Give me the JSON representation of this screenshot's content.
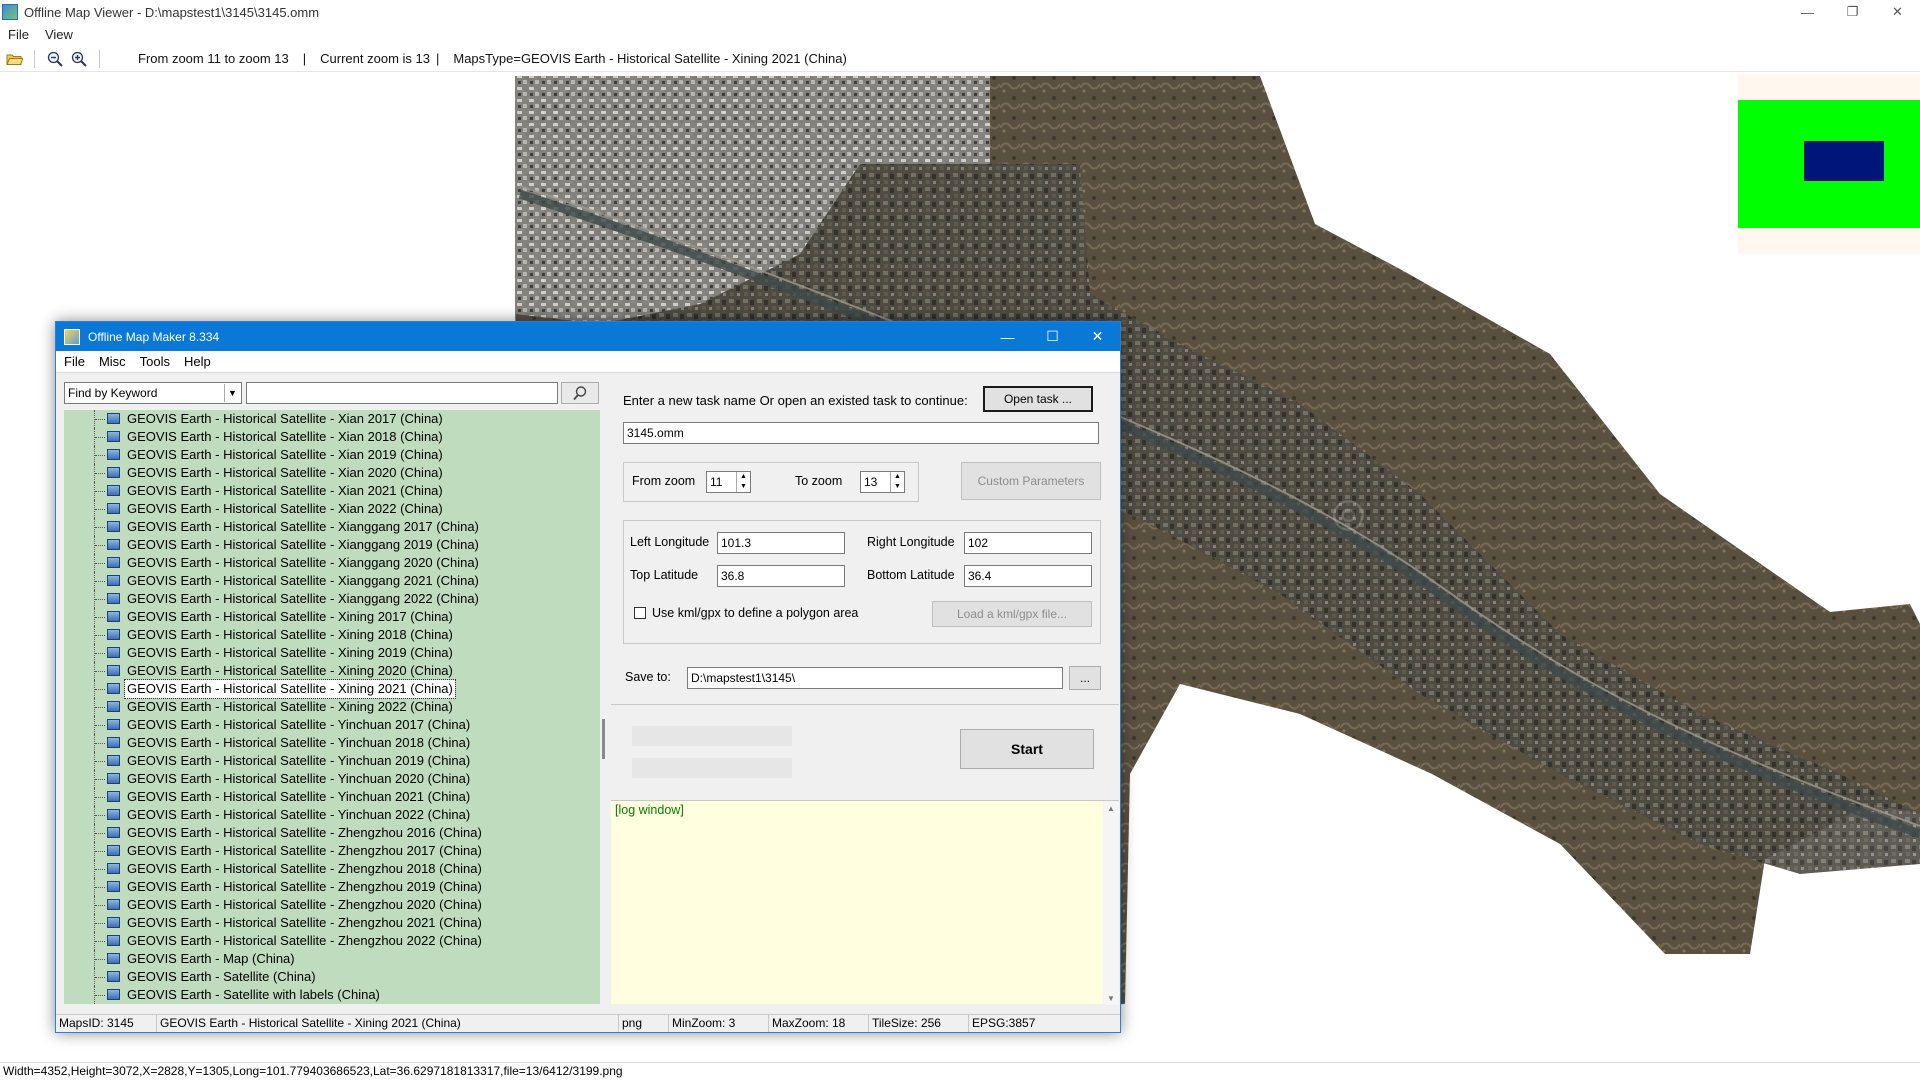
{
  "viewer": {
    "title": "Offline Map Viewer - D:\\mapstest1\\3145\\3145.omm",
    "menu": [
      "File",
      "View"
    ],
    "toolbar": {
      "zoom_range": "From zoom 11 to zoom 13",
      "sep1": "|",
      "current_zoom": "Current zoom is 13",
      "sep2": "|",
      "maps_type": "MapsType=GEOVIS Earth - Historical Satellite - Xining 2021 (China)"
    },
    "status": "Width=4352,Height=3072,X=2828,Y=1305,Long=101.779403686523,Lat=36.6297181813317,file=13/6412/3199.png",
    "window_buttons": {
      "minimize": "—",
      "restore": "❐",
      "close": "✕"
    }
  },
  "dialog": {
    "title": "Offline Map Maker 8.334",
    "menu": [
      "File",
      "Misc",
      "Tools",
      "Help"
    ],
    "window_buttons": {
      "minimize": "—",
      "maximize": "☐",
      "close": "✕"
    },
    "search": {
      "combo_value": "Find by Keyword",
      "combo_arrow": "▼",
      "keyword_value": ""
    },
    "map_list": [
      "GEOVIS Earth - Historical Satellite - Xian 2017 (China)",
      "GEOVIS Earth - Historical Satellite - Xian 2018 (China)",
      "GEOVIS Earth - Historical Satellite - Xian 2019 (China)",
      "GEOVIS Earth - Historical Satellite - Xian 2020 (China)",
      "GEOVIS Earth - Historical Satellite - Xian 2021 (China)",
      "GEOVIS Earth - Historical Satellite - Xian 2022 (China)",
      "GEOVIS Earth - Historical Satellite - Xianggang 2017 (China)",
      "GEOVIS Earth - Historical Satellite - Xianggang 2019 (China)",
      "GEOVIS Earth - Historical Satellite - Xianggang 2020 (China)",
      "GEOVIS Earth - Historical Satellite - Xianggang 2021 (China)",
      "GEOVIS Earth - Historical Satellite - Xianggang 2022 (China)",
      "GEOVIS Earth - Historical Satellite - Xining 2017 (China)",
      "GEOVIS Earth - Historical Satellite - Xining 2018 (China)",
      "GEOVIS Earth - Historical Satellite - Xining 2019 (China)",
      "GEOVIS Earth - Historical Satellite - Xining 2020 (China)",
      "GEOVIS Earth - Historical Satellite - Xining 2021 (China)",
      "GEOVIS Earth - Historical Satellite - Xining 2022 (China)",
      "GEOVIS Earth - Historical Satellite - Yinchuan 2017 (China)",
      "GEOVIS Earth - Historical Satellite - Yinchuan 2018 (China)",
      "GEOVIS Earth - Historical Satellite - Yinchuan 2019 (China)",
      "GEOVIS Earth - Historical Satellite - Yinchuan 2020 (China)",
      "GEOVIS Earth - Historical Satellite - Yinchuan 2021 (China)",
      "GEOVIS Earth - Historical Satellite - Yinchuan 2022 (China)",
      "GEOVIS Earth - Historical Satellite - Zhengzhou 2016 (China)",
      "GEOVIS Earth - Historical Satellite - Zhengzhou 2017 (China)",
      "GEOVIS Earth - Historical Satellite - Zhengzhou 2018 (China)",
      "GEOVIS Earth - Historical Satellite - Zhengzhou 2019 (China)",
      "GEOVIS Earth - Historical Satellite - Zhengzhou 2020 (China)",
      "GEOVIS Earth - Historical Satellite - Zhengzhou 2021 (China)",
      "GEOVIS Earth - Historical Satellite - Zhengzhou 2022 (China)",
      "GEOVIS Earth - Map (China)",
      "GEOVIS Earth - Satellite (China)",
      "GEOVIS Earth - Satellite with labels (China)"
    ],
    "selected_map": "GEOVIS Earth - Historical Satellite - Xining 2021 (China)",
    "task": {
      "prompt": "Enter a new task name Or open an existed task to continue:",
      "open_task_label": "Open task ...",
      "task_name": "3145.omm"
    },
    "zoom": {
      "from_label": "From zoom",
      "from_value": "11",
      "to_label": "To zoom",
      "to_value": "13",
      "custom_params_label": "Custom Parameters",
      "spin_up": "▲",
      "spin_down": "▼"
    },
    "bounds": {
      "left_lon_label": "Left Longitude",
      "left_lon": "101.3",
      "right_lon_label": "Right Longitude",
      "right_lon": "102",
      "top_lat_label": "Top Latitude",
      "top_lat": "36.8",
      "bottom_lat_label": "Bottom Latitude",
      "bottom_lat": "36.4",
      "kml_label": "Use kml/gpx to define a polygon area",
      "kml_checked": false,
      "load_kml_label": "Load a kml/gpx file..."
    },
    "save": {
      "label": "Save to:",
      "path": "D:\\mapstest1\\3145\\",
      "browse_label": "..."
    },
    "start_label": "Start",
    "log_text": "[log window]",
    "status": {
      "maps_id": "MapsID: 3145",
      "map_name": "GEOVIS Earth - Historical Satellite - Xining 2021 (China)",
      "format": "png",
      "min_zoom": "MinZoom: 3",
      "max_zoom": "MaxZoom: 18",
      "tile_size": "TileSize: 256",
      "epsg": "EPSG:3857"
    }
  },
  "colors": {
    "dialog_title_bg": "#0a78d7",
    "tree_bg": "#c0dcbe",
    "log_bg": "#ffffe0",
    "log_text": "#0c7c00",
    "overview_bg": "#00ff00",
    "overview_view": "#00157a"
  }
}
